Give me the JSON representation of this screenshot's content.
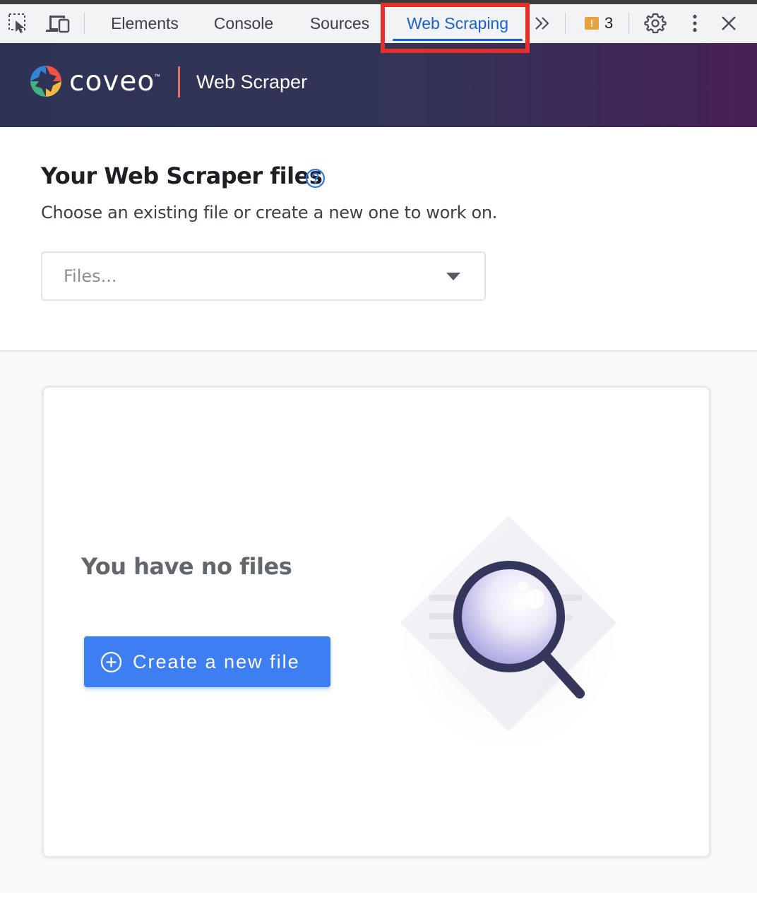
{
  "devtools": {
    "tabs": [
      "Elements",
      "Console",
      "Sources",
      "Web Scraping"
    ],
    "active_tab": "Web Scraping",
    "issues_count": "3",
    "icons": {
      "inspect": "inspect-element-icon",
      "device": "device-toolbar-icon",
      "more_tabs": "chevron-double-right-icon",
      "issues": "issue-flag-icon",
      "settings": "gear-icon",
      "menu": "kebab-menu-icon",
      "close": "close-icon"
    },
    "highlight_color": "#e3302a",
    "accent": "#1a5fd6"
  },
  "brand": {
    "logo_text": "coveo",
    "trademark": "™",
    "app_title": "Web Scraper"
  },
  "files": {
    "title": "Your Web Scraper files",
    "subtitle": "Choose an existing file or create a new one to work on.",
    "select_placeholder": "Files..."
  },
  "empty_state": {
    "title": "You have no files",
    "create_button": "Create a new file",
    "button_color": "#3d7ef2"
  }
}
